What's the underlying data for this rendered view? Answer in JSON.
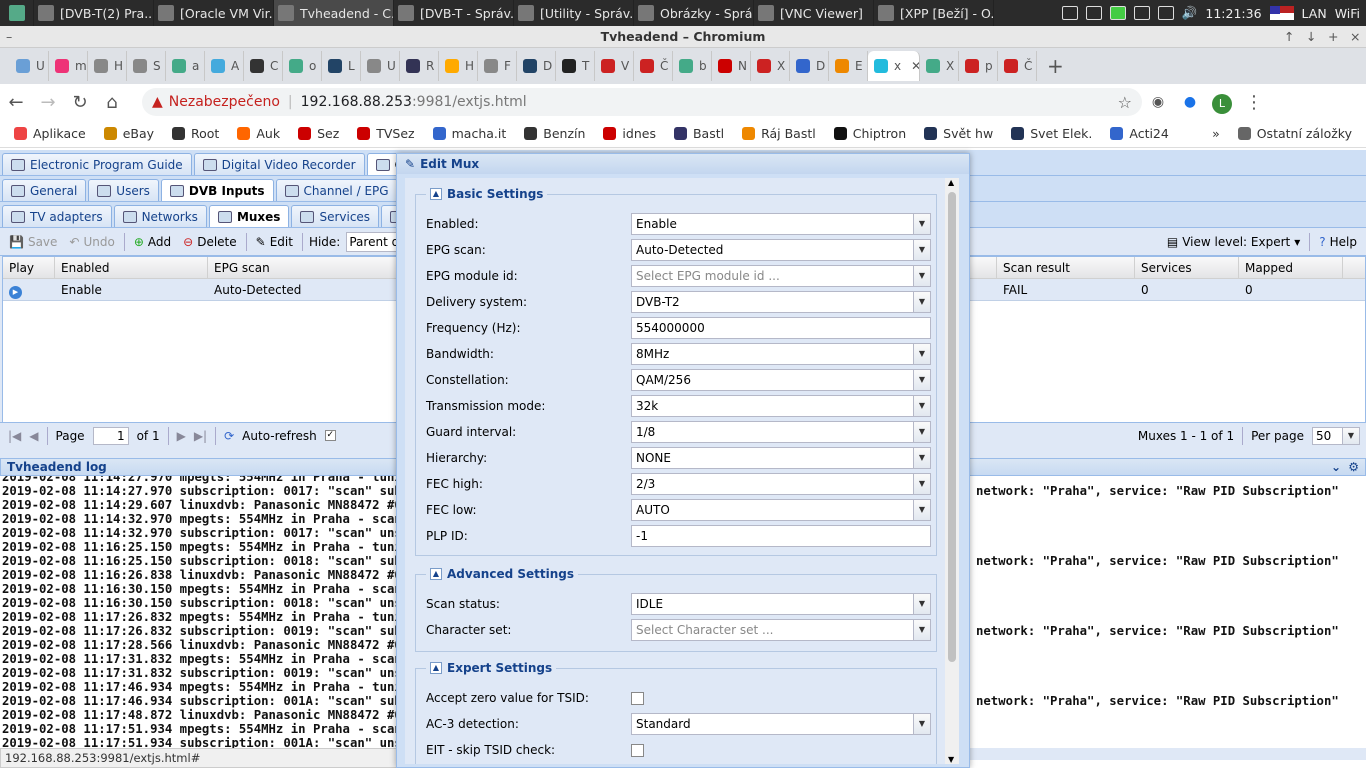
{
  "taskbar": {
    "items": [
      "[DVB-T(2) Pra...",
      "[Oracle VM Vir...",
      "Tvheadend - C...",
      "[DVB-T - Správ...",
      "[Utility - Správ...",
      "Obrázky - Sprá...",
      "[VNC Viewer]",
      "[XPP [Beží] - O..."
    ],
    "time": "11:21:36",
    "lan": "LAN",
    "wifi": "WiFi"
  },
  "window": {
    "title": "Tvheadend – Chromium"
  },
  "browser_tabs": [
    "U",
    "m",
    "H",
    "S",
    "a",
    "A",
    "C",
    "o",
    "L",
    "U",
    "R",
    "H",
    "F",
    "D",
    "T",
    "V",
    "Č",
    "b",
    "N",
    "X",
    "D",
    "E",
    "x",
    "X",
    "p",
    "Č"
  ],
  "address": {
    "insecure": "Nezabezpečeno",
    "host": "192.168.88.253",
    "path": ":9981/extjs.html"
  },
  "bookmarks": [
    "Aplikace",
    "eBay",
    "Root",
    "Auk",
    "Sez",
    "TVSez",
    "macha.it",
    "Benzín",
    "idnes",
    "Bastl",
    "Ráj Bastl",
    "Chiptron",
    "Svět hw",
    "Svet Elek.",
    "Acti24"
  ],
  "bookmarks_other": "Ostatní záložky",
  "app": {
    "tabs1": [
      "Electronic Program Guide",
      "Digital Video Recorder",
      "Configurat"
    ],
    "tabs2": [
      "General",
      "Users",
      "DVB Inputs",
      "Channel / EPG",
      "Str"
    ],
    "tabs3": [
      "TV adapters",
      "Networks",
      "Muxes",
      "Services",
      "Mux S"
    ],
    "toolbar": {
      "save": "Save",
      "undo": "Undo",
      "add": "Add",
      "delete": "Delete",
      "edit": "Edit",
      "hide_label": "Hide:",
      "hide_value": "Parent disabled",
      "view_level": "View level: Expert",
      "help": "Help"
    },
    "grid": {
      "headers": [
        "Play",
        "Enabled",
        "EPG scan",
        "Scan result",
        "Services",
        "Mapped"
      ],
      "row": {
        "enabled": "Enable",
        "epg": "Auto-Detected",
        "scan_result": "FAIL",
        "services": "0",
        "mapped": "0"
      }
    },
    "pager": {
      "page_label": "Page",
      "page": "1",
      "of": "of 1",
      "autorefresh": "Auto-refresh",
      "count": "Muxes 1 - 1 of 1",
      "per_page_label": "Per page",
      "per_page": "50"
    },
    "log_title": "Tvheadend log",
    "log_lines": [
      "2019-02-08 11:14:27.970 mpegts: 554MHz in Praha - tuni",
      "2019-02-08 11:14:27.970 subscription: 0017: \"scan\" subs",
      "2019-02-08 11:14:29.607 linuxdvb: Panasonic MN88472 #0",
      "2019-02-08 11:14:32.970 mpegts: 554MHz in Praha - scan",
      "2019-02-08 11:14:32.970 subscription: 0017: \"scan\" unsu",
      "2019-02-08 11:16:25.150 mpegts: 554MHz in Praha - tunin",
      "2019-02-08 11:16:25.150 subscription: 0018: \"scan\" subs",
      "2019-02-08 11:16:26.838 linuxdvb: Panasonic MN88472 #0",
      "2019-02-08 11:16:30.150 mpegts: 554MHz in Praha - scan",
      "2019-02-08 11:16:30.150 subscription: 0018: \"scan\" unsu",
      "2019-02-08 11:17:26.832 mpegts: 554MHz in Praha - tunin",
      "2019-02-08 11:17:26.832 subscription: 0019: \"scan\" subs",
      "2019-02-08 11:17:28.566 linuxdvb: Panasonic MN88472 #0",
      "2019-02-08 11:17:31.832 mpegts: 554MHz in Praha - scan",
      "2019-02-08 11:17:31.832 subscription: 0019: \"scan\" unsu",
      "2019-02-08 11:17:46.934 mpegts: 554MHz in Praha - tunin",
      "2019-02-08 11:17:46.934 subscription: 001A: \"scan\" subs",
      "2019-02-08 11:17:48.872 linuxdvb: Panasonic MN88472 #0",
      "2019-02-08 11:17:51.934 mpegts: 554MHz in Praha - scan",
      "2019-02-08 11:17:51.934 subscription: 001A: \"scan\" unsu"
    ],
    "log_right": "network: \"Praha\", service: \"Raw PID Subscription\""
  },
  "status_url": "192.168.88.253:9981/extjs.html#",
  "dialog": {
    "title": "Edit Mux",
    "basic_title": "Basic Settings",
    "basic": [
      {
        "label": "Enabled:",
        "value": "Enable",
        "type": "combo"
      },
      {
        "label": "EPG scan:",
        "value": "Auto-Detected",
        "type": "combo"
      },
      {
        "label": "EPG module id:",
        "value": "Select EPG module id ...",
        "type": "placeholder"
      },
      {
        "label": "Delivery system:",
        "value": "DVB-T2",
        "type": "combo"
      },
      {
        "label": "Frequency (Hz):",
        "value": "554000000",
        "type": "text"
      },
      {
        "label": "Bandwidth:",
        "value": "8MHz",
        "type": "combo"
      },
      {
        "label": "Constellation:",
        "value": "QAM/256",
        "type": "combo"
      },
      {
        "label": "Transmission mode:",
        "value": "32k",
        "type": "combo"
      },
      {
        "label": "Guard interval:",
        "value": "1/8",
        "type": "combo"
      },
      {
        "label": "Hierarchy:",
        "value": "NONE",
        "type": "combo"
      },
      {
        "label": "FEC high:",
        "value": "2/3",
        "type": "combo"
      },
      {
        "label": "FEC low:",
        "value": "AUTO",
        "type": "combo"
      },
      {
        "label": "PLP ID:",
        "value": "-1",
        "type": "text"
      }
    ],
    "advanced_title": "Advanced Settings",
    "advanced": [
      {
        "label": "Scan status:",
        "value": "IDLE",
        "type": "combo"
      },
      {
        "label": "Character set:",
        "value": "Select Character set ...",
        "type": "placeholder"
      }
    ],
    "expert_title": "Expert Settings",
    "expert": [
      {
        "label": "Accept zero value for TSID:",
        "type": "check"
      },
      {
        "label": "AC-3 detection:",
        "value": "Standard",
        "type": "combo"
      },
      {
        "label": "EIT - skip TSID check:",
        "type": "check"
      }
    ]
  }
}
